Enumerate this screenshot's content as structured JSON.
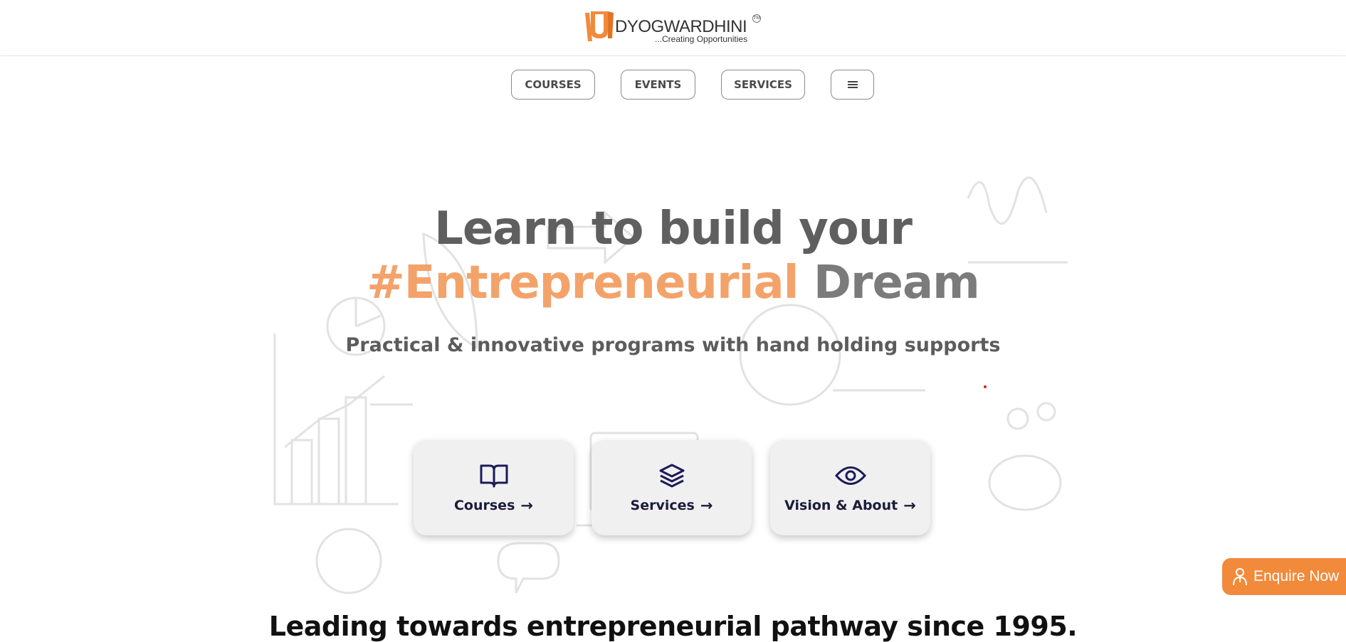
{
  "brand": {
    "logo_letter": "U",
    "name": "DYOGWARDHINI",
    "tagline": "...Creating Opportunities",
    "tm": "TM",
    "color": "#f28a3b"
  },
  "nav": {
    "items": [
      {
        "label": "COURSES"
      },
      {
        "label": "EVENTS"
      },
      {
        "label": "SERVICES"
      }
    ],
    "menu_icon": "hamburger-icon"
  },
  "hero": {
    "title_line1": "Learn to build your",
    "title_accent": "#Entrepreneurial",
    "title_rest": "Dream",
    "subtitle": "Practical & innovative programs with hand holding supports",
    "accent_color": "#f3a36a"
  },
  "cards": [
    {
      "label": "Courses",
      "icon": "book-icon"
    },
    {
      "label": "Services",
      "icon": "layers-icon"
    },
    {
      "label": "Vision & About",
      "icon": "eye-icon"
    }
  ],
  "section": {
    "heading": "Leading towards entrepreneurial pathway since 1995."
  },
  "enquire": {
    "label": "Enquire Now",
    "icon": "person-icon",
    "color": "#f28a3b"
  }
}
